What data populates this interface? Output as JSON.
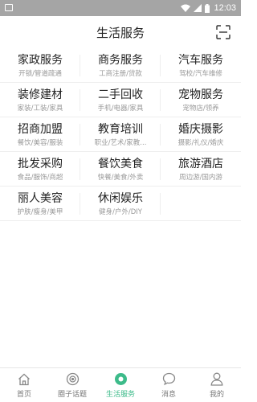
{
  "status_bar": {
    "time": "12:03",
    "icons": [
      "photo-icon",
      "wifi-icon",
      "signal-icon",
      "battery-icon"
    ]
  },
  "header": {
    "title": "生活服务",
    "scan_icon": "scan-icon"
  },
  "services": [
    {
      "title": "家政服务",
      "sub": "开锁/管道疏通"
    },
    {
      "title": "商务服务",
      "sub": "工商注册/贷款"
    },
    {
      "title": "汽车服务",
      "sub": "驾校/汽车维修"
    },
    {
      "title": "装修建材",
      "sub": "家装/工装/家具"
    },
    {
      "title": "二手回收",
      "sub": "手机/电器/家具"
    },
    {
      "title": "宠物服务",
      "sub": "宠物店/领养"
    },
    {
      "title": "招商加盟",
      "sub": "餐饮/美容/服装"
    },
    {
      "title": "教育培训",
      "sub": "职业/艺术/家教..."
    },
    {
      "title": "婚庆摄影",
      "sub": "摄影/礼仪/婚庆"
    },
    {
      "title": "批发采购",
      "sub": "食品/服饰/商超"
    },
    {
      "title": "餐饮美食",
      "sub": "快餐/美食/外卖"
    },
    {
      "title": "旅游酒店",
      "sub": "周边游/国内游"
    },
    {
      "title": "丽人美容",
      "sub": "护肤/瘦身/美甲"
    },
    {
      "title": "休闲娱乐",
      "sub": "健身/户外/DIY"
    }
  ],
  "bottom_nav": [
    {
      "label": "首页",
      "icon": "home-icon",
      "active": false
    },
    {
      "label": "圈子话题",
      "icon": "circle-topic-icon",
      "active": false
    },
    {
      "label": "生活服务",
      "icon": "life-service-icon",
      "active": true
    },
    {
      "label": "消息",
      "icon": "message-icon",
      "active": false
    },
    {
      "label": "我的",
      "icon": "profile-icon",
      "active": false
    }
  ],
  "colors": {
    "status_bar_bg": "#a5a5a5",
    "accent": "#3dbb8a",
    "title_text": "#222222",
    "sub_text": "#999999",
    "divider": "#eeeeee"
  }
}
